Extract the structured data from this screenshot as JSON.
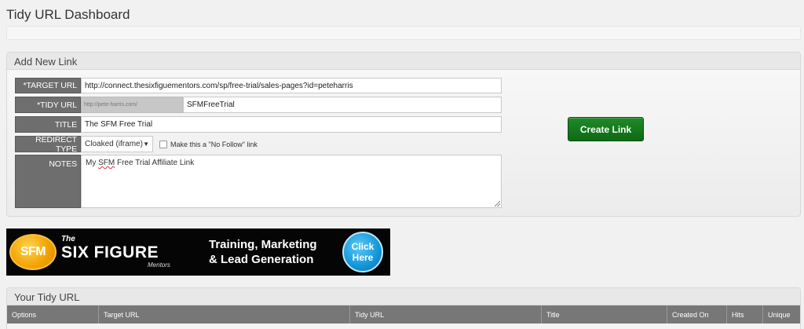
{
  "page": {
    "title": "Tidy URL Dashboard"
  },
  "add_link": {
    "heading": "Add New Link",
    "target_url": {
      "label": "*TARGET URL",
      "value": "http://connect.thesixfiguementors.com/sp/free-trial/sales-pages?id=peteharris"
    },
    "tidy_url": {
      "label": "*TIDY URL",
      "prefix": "http://pete-harris.com/",
      "value": "SFMFreeTrial"
    },
    "title": {
      "label": "TITLE",
      "value": "The SFM Free Trial"
    },
    "redirect": {
      "label": "REDIRECT TYPE",
      "selected": "Cloaked (iframe)",
      "nofollow_label": "Make this a \"No Follow\" link"
    },
    "notes": {
      "label": "NOTES",
      "value_pre": "My ",
      "value_flag": "SFM",
      "value_post": " Free Trial Affiliate Link"
    },
    "create_button": "Create Link"
  },
  "banner": {
    "logo_text": "SFM",
    "the": "The",
    "brand": "SIX FIGURE",
    "mentors": "Mentors",
    "tagline_line1": "Training, Marketing",
    "tagline_line2": "& Lead Generation",
    "cta_line1": "Click",
    "cta_line2": "Here"
  },
  "tidy_table": {
    "heading": "Your Tidy URL",
    "columns": [
      "Options",
      "Target URL",
      "Tidy URL",
      "Title",
      "Created On",
      "Hits",
      "Unique"
    ]
  },
  "colors": {
    "label_bg": "#6e6e6e",
    "button_green": "#1a7f23",
    "banner_bg": "#050505",
    "logo_orange": "#f2a100",
    "cta_blue": "#1296d8"
  }
}
